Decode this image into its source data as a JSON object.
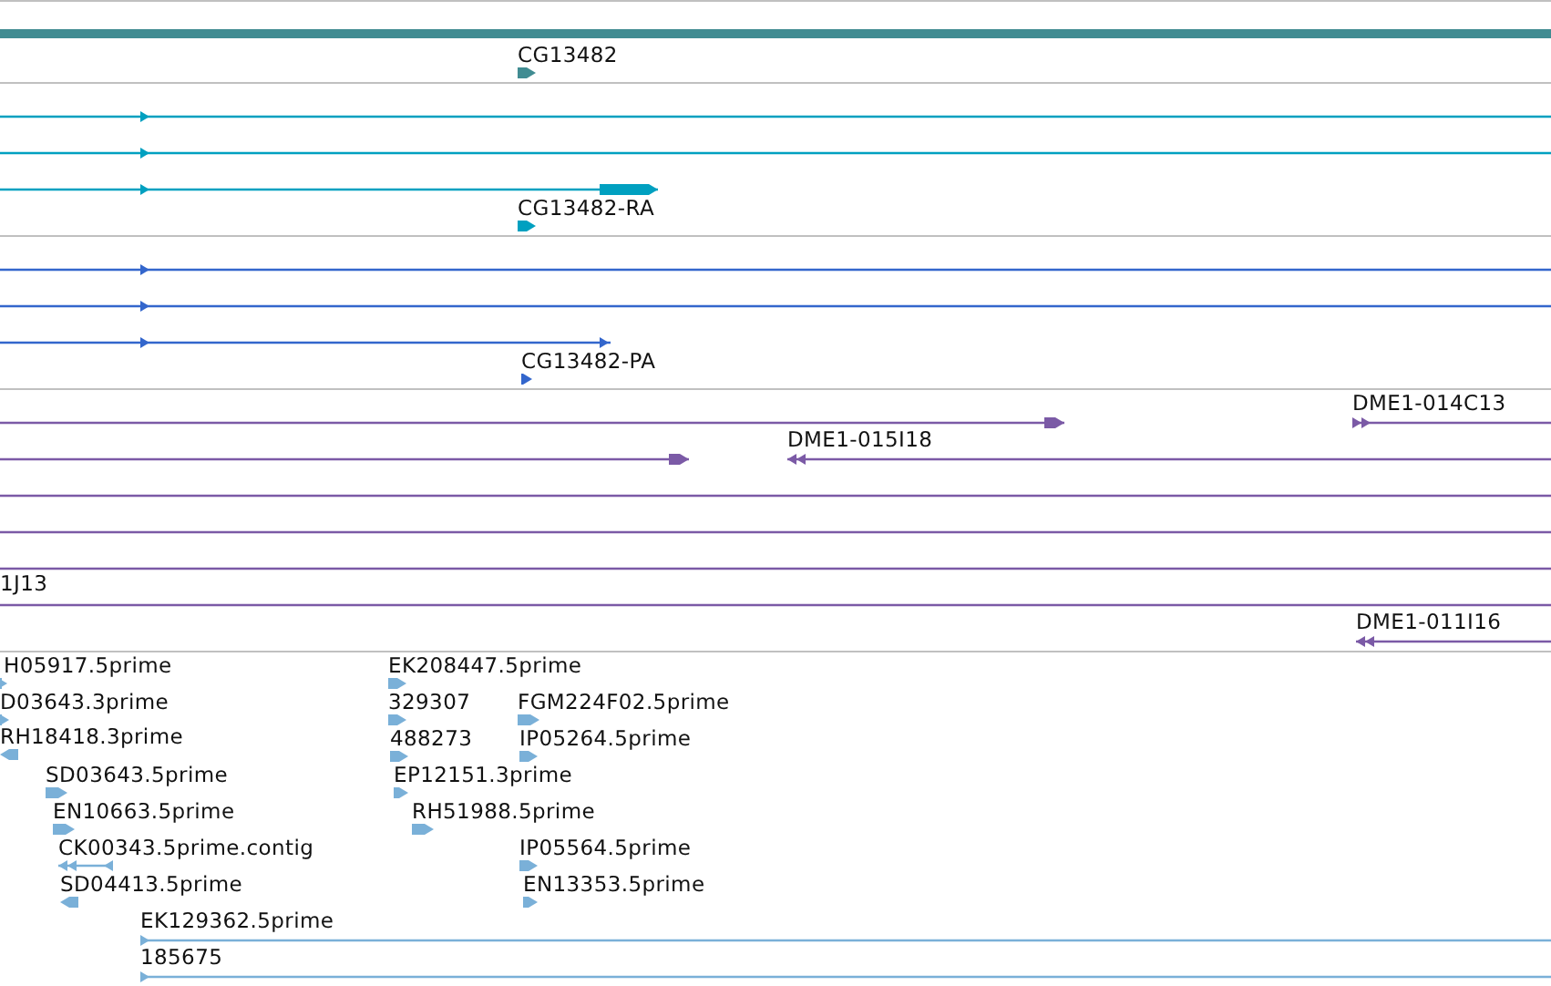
{
  "tracks": [
    {
      "kind": "gene",
      "features": [
        {
          "label": "CG13482",
          "reverse": false
        }
      ]
    },
    {
      "kind": "transcript",
      "features": [
        {
          "reverse": false
        },
        {
          "reverse": false
        },
        {
          "reverse": false
        },
        {
          "label": "CG13482-RA",
          "reverse": false
        }
      ]
    },
    {
      "kind": "protein",
      "features": [
        {
          "reverse": false
        },
        {
          "reverse": false
        },
        {
          "reverse": false
        },
        {
          "label": "CG13482-PA",
          "reverse": false
        }
      ]
    },
    {
      "kind": "clone",
      "features": [
        {
          "kind": "directed",
          "reverse": false
        },
        {
          "kind": "directed",
          "label": "DME1-014C13",
          "reverse": false
        },
        {
          "kind": "directed",
          "reverse": false
        },
        {
          "kind": "directed",
          "label": "DME1-015I18",
          "reverse": true
        },
        {
          "kind": "plain"
        },
        {
          "kind": "plain"
        },
        {
          "kind": "plain"
        },
        {
          "kind": "plain",
          "label": "1J13"
        },
        {
          "kind": "directed",
          "label": "DME1-011I16",
          "reverse": true
        }
      ]
    },
    {
      "kind": "est",
      "features": [
        {
          "label": "H05917.5prime",
          "reverse": false
        },
        {
          "label": "D03643.3prime",
          "reverse": false
        },
        {
          "label": "RH18418.3prime",
          "reverse": true
        },
        {
          "label": "SD03643.5prime",
          "reverse": false
        },
        {
          "label": "EN10663.5prime",
          "reverse": false
        },
        {
          "label": "CK00343.5prime.contig",
          "reverse": true
        },
        {
          "label": "SD04413.5prime",
          "reverse": true
        },
        {
          "label": "EK129362.5prime",
          "reverse": false
        },
        {
          "label": "185675",
          "reverse": false
        },
        {
          "label": "EK208447.5prime",
          "reverse": false
        },
        {
          "label": "329307",
          "reverse": false
        },
        {
          "label": "FGM224F02.5prime",
          "reverse": false
        },
        {
          "label": "488273",
          "reverse": false
        },
        {
          "label": "IP05264.5prime",
          "reverse": false
        },
        {
          "label": "EP12151.3prime",
          "reverse": false
        },
        {
          "label": "RH51988.5prime",
          "reverse": false
        },
        {
          "label": "IP05564.5prime",
          "reverse": false
        },
        {
          "label": "EN13353.5prime",
          "reverse": false
        }
      ]
    }
  ]
}
